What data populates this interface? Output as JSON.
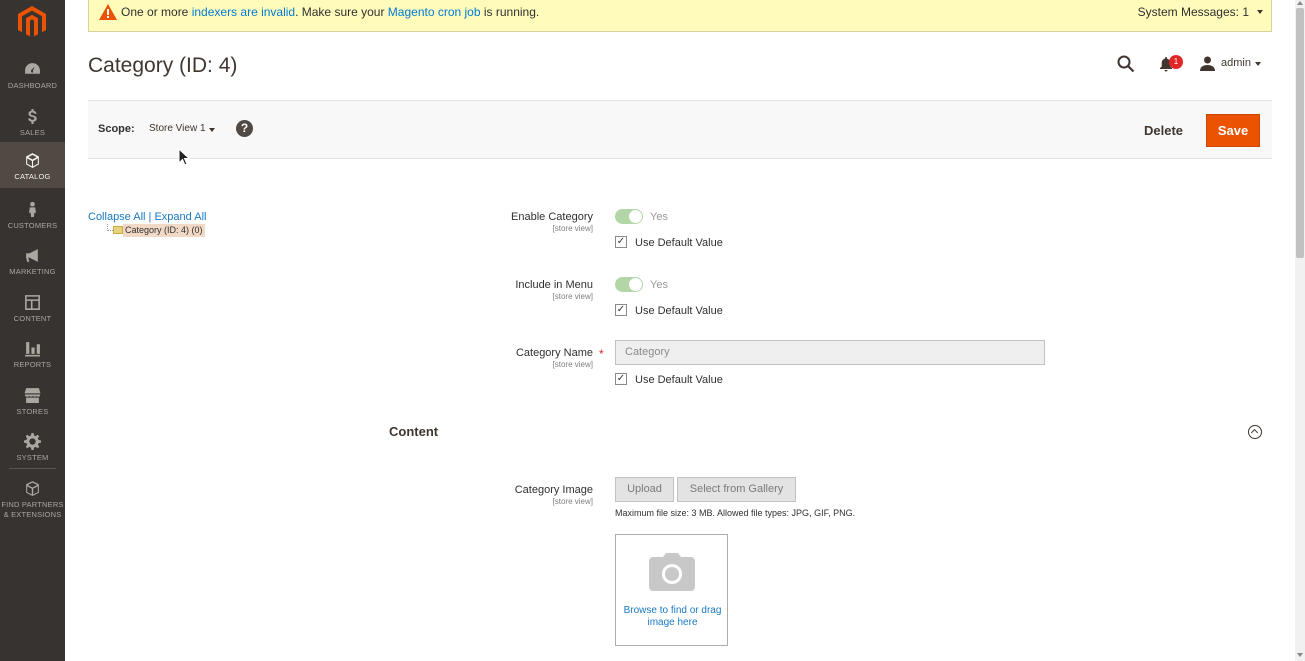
{
  "sidebar": {
    "logo": "magento-logo",
    "items": [
      {
        "label": "DASHBOARD",
        "icon": "dashboard-icon"
      },
      {
        "label": "SALES",
        "icon": "dollar-icon"
      },
      {
        "label": "CATALOG",
        "icon": "cube-icon",
        "active": true
      },
      {
        "label": "CUSTOMERS",
        "icon": "person-icon"
      },
      {
        "label": "MARKETING",
        "icon": "megaphone-icon"
      },
      {
        "label": "CONTENT",
        "icon": "layout-icon"
      },
      {
        "label": "REPORTS",
        "icon": "bar-chart-icon"
      },
      {
        "label": "STORES",
        "icon": "storefront-icon"
      },
      {
        "label": "SYSTEM",
        "icon": "gear-icon"
      },
      {
        "label": "FIND PARTNERS",
        "label2": "& EXTENSIONS",
        "icon": "box-icon"
      }
    ]
  },
  "message_bar": {
    "prefix": "One or more ",
    "link1": "indexers are invalid",
    "middle": ". Make sure your ",
    "link2": "Magento cron job",
    "suffix": " is running.",
    "system_messages": "System Messages: 1"
  },
  "header": {
    "title": "Category (ID: 4)",
    "notification_count": "1",
    "user": "admin"
  },
  "actionbar": {
    "scope_label": "Scope:",
    "scope_value": "Store View 1",
    "help": "?",
    "delete_label": "Delete",
    "save_label": "Save"
  },
  "tree": {
    "collapse_all": "Collapse All",
    "separator": "|",
    "expand_all": "Expand All",
    "node_label": "Category (ID: 4) (0)"
  },
  "form": {
    "enable_category": {
      "label": "Enable Category",
      "scope": "[store view]",
      "value": "Yes",
      "default_label": "Use Default Value",
      "default_checked": true
    },
    "include_in_menu": {
      "label": "Include in Menu",
      "scope": "[store view]",
      "value": "Yes",
      "default_label": "Use Default Value",
      "default_checked": true
    },
    "category_name": {
      "label": "Category Name",
      "scope": "[store view]",
      "required": "*",
      "value": "Category",
      "default_label": "Use Default Value",
      "default_checked": true
    }
  },
  "content_section": {
    "title": "Content",
    "image_label": "Category Image",
    "image_scope": "[store view]",
    "upload_label": "Upload",
    "gallery_label": "Select from Gallery",
    "note": "Maximum file size: 3 MB. Allowed file types: JPG, GIF, PNG.",
    "dropzone_text": "Browse to find or drag image here"
  },
  "colors": {
    "sidebar_bg": "#373330",
    "save_button": "#eb5202",
    "message_bg": "#fffbbb",
    "link": "#1979c3"
  }
}
